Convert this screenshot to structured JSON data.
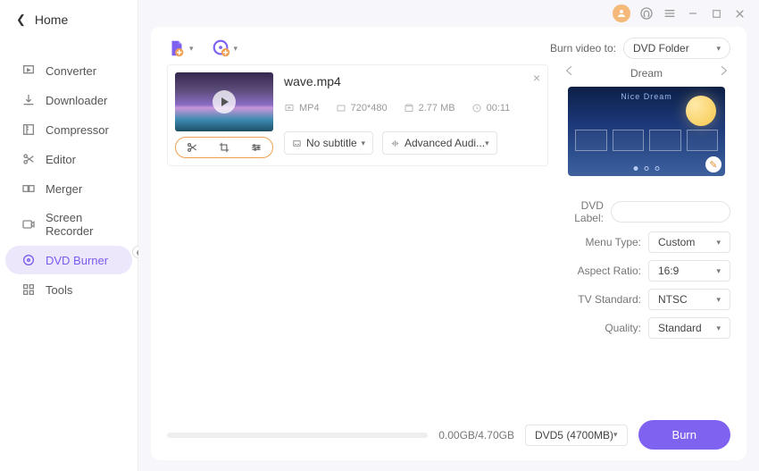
{
  "sidebar": {
    "home": "Home",
    "items": [
      {
        "label": "Converter"
      },
      {
        "label": "Downloader"
      },
      {
        "label": "Compressor"
      },
      {
        "label": "Editor"
      },
      {
        "label": "Merger"
      },
      {
        "label": "Screen Recorder"
      },
      {
        "label": "DVD Burner"
      },
      {
        "label": "Tools"
      }
    ]
  },
  "top": {
    "burn_to_label": "Burn video to:",
    "burn_to_value": "DVD Folder"
  },
  "file": {
    "name": "wave.mp4",
    "format": "MP4",
    "resolution": "720*480",
    "size": "2.77 MB",
    "duration": "00:11",
    "subtitle": "No subtitle",
    "audio": "Advanced Audi..."
  },
  "preview": {
    "title": "Dream",
    "inner_label": "Nice Dream"
  },
  "settings": {
    "labels": {
      "dvd_label": "DVD Label:",
      "menu_type": "Menu Type:",
      "aspect": "Aspect Ratio:",
      "tv": "TV Standard:",
      "quality": "Quality:"
    },
    "values": {
      "dvd_label": "",
      "menu_type": "Custom",
      "aspect": "16:9",
      "tv": "NTSC",
      "quality": "Standard"
    }
  },
  "bottom": {
    "progress_text": "0.00GB/4.70GB",
    "disc": "DVD5 (4700MB)",
    "burn": "Burn"
  }
}
